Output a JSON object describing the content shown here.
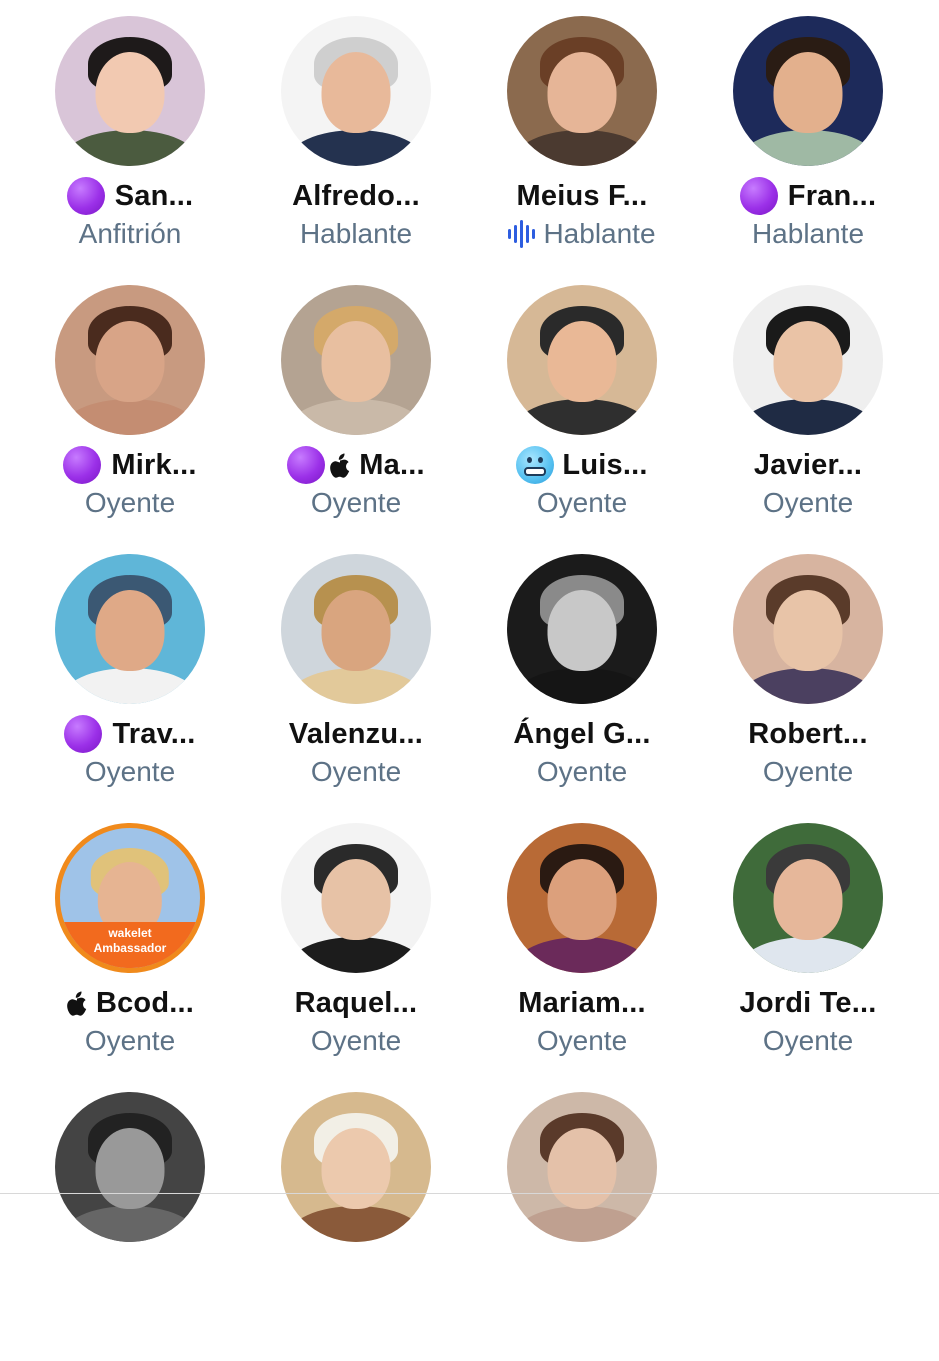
{
  "participants": [
    {
      "name": "San...",
      "role": "Anfitrión",
      "prefix": [
        "purple-dot"
      ],
      "avatar_colors": [
        "#d9c5d8",
        "#f2c9b1",
        "#1e1a1a",
        "#4b5b3f"
      ]
    },
    {
      "name": "Alfredo...",
      "role": "Hablante",
      "prefix": [],
      "avatar_colors": [
        "#f4f4f4",
        "#e8b99a",
        "#cfcfcf",
        "#24324f"
      ]
    },
    {
      "name": "Meius F...",
      "role": "Hablante",
      "prefix": [],
      "speaking": true,
      "avatar_colors": [
        "#8b6a4e",
        "#e6b597",
        "#6a3f26",
        "#4b3a30"
      ]
    },
    {
      "name": "Fran...",
      "role": "Hablante",
      "prefix": [
        "purple-dot"
      ],
      "avatar_colors": [
        "#1d2a5a",
        "#e3b08d",
        "#2a1c14",
        "#9fb9a4"
      ]
    },
    {
      "name": "Mirk...",
      "role": "Oyente",
      "prefix": [
        "purple-dot"
      ],
      "avatar_colors": [
        "#c89a80",
        "#d8a487",
        "#4a2b1e",
        "#c48d72"
      ]
    },
    {
      "name": "Ma...",
      "role": "Oyente",
      "prefix": [
        "purple-dot",
        "apple"
      ],
      "avatar_colors": [
        "#b4a392",
        "#e8bfa0",
        "#d4a96a",
        "#c9b9a8"
      ]
    },
    {
      "name": "Luis...",
      "role": "Oyente",
      "prefix": [
        "cold-face-emoji"
      ],
      "avatar_colors": [
        "#d6b896",
        "#e9b896",
        "#2a2a2a",
        "#2f2f2f"
      ]
    },
    {
      "name": "Javier...",
      "role": "Oyente",
      "prefix": [],
      "avatar_colors": [
        "#efefef",
        "#eac3a6",
        "#1a1a1a",
        "#1f2b44"
      ]
    },
    {
      "name": "Trav...",
      "role": "Oyente",
      "prefix": [
        "purple-dot"
      ],
      "avatar_colors": [
        "#5fb6d8",
        "#dfa987",
        "#3b5873",
        "#f2f2f2"
      ]
    },
    {
      "name": "Valenzu...",
      "role": "Oyente",
      "prefix": [],
      "avatar_colors": [
        "#cfd6dc",
        "#d9a57f",
        "#b7914f",
        "#e2c99a"
      ]
    },
    {
      "name": "Ángel G...",
      "role": "Oyente",
      "prefix": [],
      "avatar_colors": [
        "#1b1b1b",
        "#c8c8c8",
        "#8a8a8a",
        "#151515"
      ]
    },
    {
      "name": "Robert...",
      "role": "Oyente",
      "prefix": [],
      "avatar_colors": [
        "#d7b4a0",
        "#e8c4a8",
        "#5a3b2a",
        "#4b4060"
      ]
    },
    {
      "name": "Bcod...",
      "role": "Oyente",
      "prefix": [
        "apple"
      ],
      "ring": true,
      "badge_line1": "wakelet",
      "badge_line2": "Ambassador",
      "avatar_colors": [
        "#9fc3e8",
        "#e6b492",
        "#e0c27a",
        "#f26a1e"
      ]
    },
    {
      "name": "Raquel...",
      "role": "Oyente",
      "prefix": [],
      "avatar_colors": [
        "#f3f3f3",
        "#e7c2a6",
        "#2a2a2a",
        "#1c1c1c"
      ]
    },
    {
      "name": "Mariam...",
      "role": "Oyente",
      "prefix": [],
      "avatar_colors": [
        "#b86a36",
        "#dca07c",
        "#2a1a12",
        "#6b2a5a"
      ]
    },
    {
      "name": "Jordi Te...",
      "role": "Oyente",
      "prefix": [],
      "avatar_colors": [
        "#3f6b3a",
        "#e6b79a",
        "#3a3a3a",
        "#dfe6ee"
      ]
    },
    {
      "name": "",
      "role": "",
      "prefix": [],
      "avatar_colors": [
        "#444444",
        "#999999",
        "#222222",
        "#666666"
      ]
    },
    {
      "name": "",
      "role": "",
      "prefix": [],
      "avatar_colors": [
        "#d6b98e",
        "#ecc9ad",
        "#f2efe6",
        "#8a5a3a"
      ]
    },
    {
      "name": "",
      "role": "",
      "prefix": [],
      "avatar_colors": [
        "#cdb8a8",
        "#e4c1a9",
        "#5a3a2a",
        "#bfa090"
      ]
    }
  ]
}
